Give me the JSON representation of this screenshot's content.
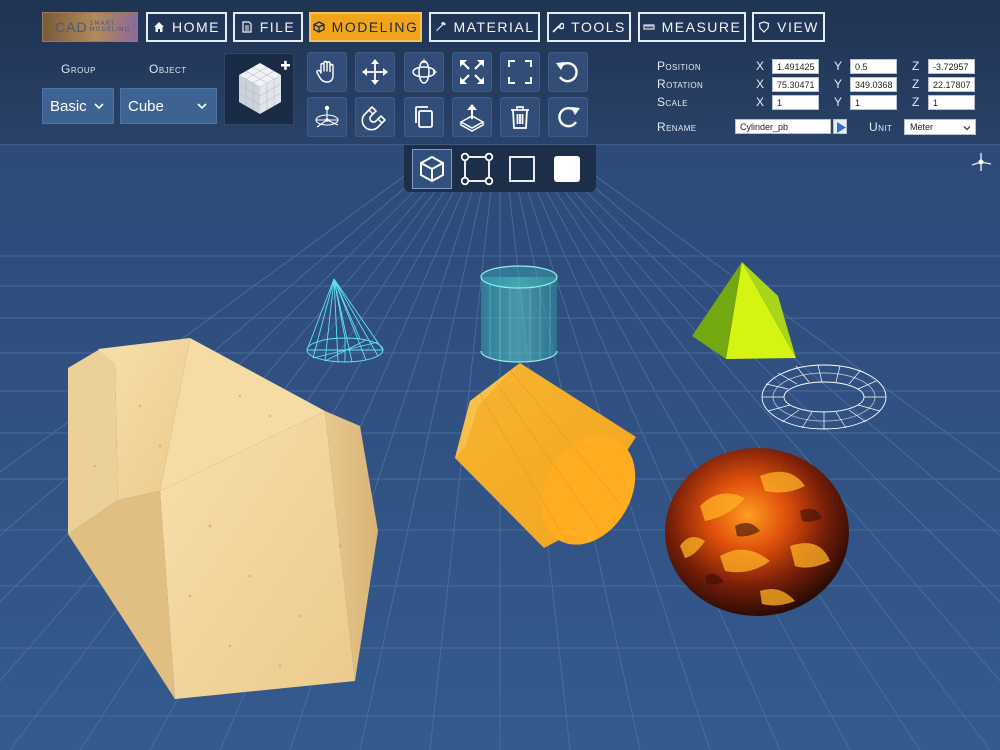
{
  "logo": {
    "main": "CAD",
    "sub_line1": "SMART",
    "sub_line2": "MODELING"
  },
  "nav": [
    {
      "label": "HOME",
      "icon": "home-icon",
      "active": false
    },
    {
      "label": "FILE",
      "icon": "file-icon",
      "active": false
    },
    {
      "label": "MODELING",
      "icon": "cube-icon",
      "active": true
    },
    {
      "label": "MATERIAL",
      "icon": "dropper-icon",
      "active": false
    },
    {
      "label": "TOOLS",
      "icon": "wrench-icon",
      "active": false
    },
    {
      "label": "MEASURE",
      "icon": "ruler-icon",
      "active": false
    },
    {
      "label": "VIEW",
      "icon": "shield-icon",
      "active": false
    }
  ],
  "modeling": {
    "group_label": "Group",
    "object_label": "Object",
    "group_value": "Basic",
    "object_value": "Cube"
  },
  "tools": [
    "hand-icon",
    "move-icon",
    "rotate-icon",
    "scale-icon",
    "frame-icon",
    "undo-icon",
    "pivot-icon",
    "snap-magnet-icon",
    "duplicate-icon",
    "export-icon",
    "trash-icon",
    "redo-icon"
  ],
  "transform": {
    "position_label": "Position",
    "rotation_label": "Rotation",
    "scale_label": "Scale",
    "x_label": "X",
    "y_label": "Y",
    "z_label": "Z",
    "position": {
      "x": "1.491425",
      "y": "0.5",
      "z": "-3.72957"
    },
    "rotation": {
      "x": "75.30471",
      "y": "349.0368",
      "z": "22.17807"
    },
    "scale": {
      "x": "1",
      "y": "1",
      "z": "1"
    },
    "rename_label": "Rename",
    "rename_value": "Cylinder_pb",
    "unit_label": "Unit",
    "unit_value": "Meter"
  },
  "submodes": [
    "object-mode-icon",
    "vertex-mode-icon",
    "wireframe-mode-icon",
    "solid-mode-icon"
  ],
  "colors": {
    "accent": "#f2a51a",
    "panel": "#223857",
    "viewport": "#2f4f80",
    "grid": "#5a78a8"
  }
}
